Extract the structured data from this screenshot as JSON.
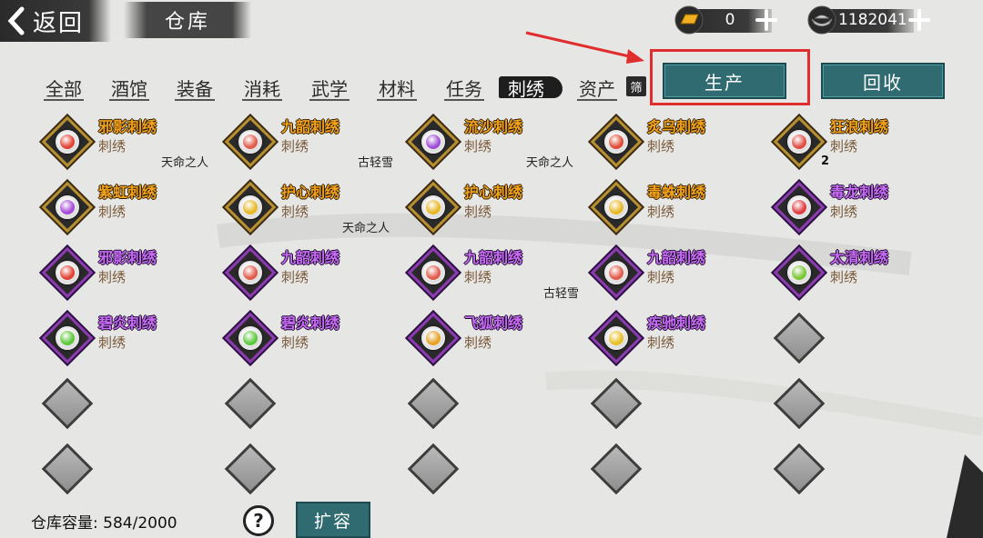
{
  "header": {
    "back_label": "返回",
    "warehouse_tab": "仓库",
    "gold_value": "0",
    "silver_value": "1182041",
    "gold_icon": "gold-ingot-icon",
    "silver_icon": "silver-ingot-icon"
  },
  "categories": [
    {
      "label": "全部",
      "active": false
    },
    {
      "label": "酒馆",
      "active": false
    },
    {
      "label": "装备",
      "active": false
    },
    {
      "label": "消耗",
      "active": false
    },
    {
      "label": "武学",
      "active": false
    },
    {
      "label": "材料",
      "active": false
    },
    {
      "label": "任务",
      "active": false
    },
    {
      "label": "刺绣",
      "active": true
    },
    {
      "label": "资产",
      "active": false
    }
  ],
  "filter_label": "筛",
  "actions": {
    "produce": "生产",
    "recycle": "回收"
  },
  "items": [
    {
      "name": "邪影刺绣",
      "type": "刺绣",
      "rarity": "gold",
      "orb": "#e24030",
      "owner": ""
    },
    {
      "name": "九韶刺绣",
      "type": "刺绣",
      "rarity": "gold",
      "orb": "#e25a4a",
      "owner": ""
    },
    {
      "name": "流沙刺绣",
      "type": "刺绣",
      "rarity": "gold",
      "orb": "#a04ad8",
      "owner": "天命之人"
    },
    {
      "name": "炙乌刺绣",
      "type": "刺绣",
      "rarity": "gold",
      "orb": "#e04a30",
      "owner": "古轻雪"
    },
    {
      "name": "狂浪刺绣",
      "type": "刺绣",
      "rarity": "gold",
      "orb": "#e04a40",
      "owner": "天命之人",
      "count": "2"
    },
    {
      "name": "紫虹刺绣",
      "type": "刺绣",
      "rarity": "gold",
      "orb": "#a648d8",
      "owner": ""
    },
    {
      "name": "护心刺绣",
      "type": "刺绣",
      "rarity": "gold",
      "orb": "#e8b820",
      "owner": ""
    },
    {
      "name": "护心刺绣",
      "type": "刺绣",
      "rarity": "gold",
      "orb": "#e8b820",
      "owner": "天命之人"
    },
    {
      "name": "毒蛛刺绣",
      "type": "刺绣",
      "rarity": "gold",
      "orb": "#e8b820",
      "owner": ""
    },
    {
      "name": "毒龙刺绣",
      "type": "刺绣",
      "rarity": "purple",
      "orb": "#e03a40",
      "owner": ""
    },
    {
      "name": "邪影刺绣",
      "type": "刺绣",
      "rarity": "purple",
      "orb": "#e24030",
      "owner": ""
    },
    {
      "name": "九韶刺绣",
      "type": "刺绣",
      "rarity": "purple",
      "orb": "#e25a4a",
      "owner": ""
    },
    {
      "name": "九韶刺绣",
      "type": "刺绣",
      "rarity": "purple",
      "orb": "#e25a4a",
      "owner": ""
    },
    {
      "name": "九韶刺绣",
      "type": "刺绣",
      "rarity": "purple",
      "orb": "#e25a4a",
      "owner": "古轻雪"
    },
    {
      "name": "太清刺绣",
      "type": "刺绣",
      "rarity": "purple",
      "orb": "#78c830",
      "owner": ""
    },
    {
      "name": "碧炎刺绣",
      "type": "刺绣",
      "rarity": "purple",
      "orb": "#5ac838",
      "owner": ""
    },
    {
      "name": "碧炎刺绣",
      "type": "刺绣",
      "rarity": "purple",
      "orb": "#5ac838",
      "owner": ""
    },
    {
      "name": "飞狐刺绣",
      "type": "刺绣",
      "rarity": "purple",
      "orb": "#e8a020",
      "owner": ""
    },
    {
      "name": "疾驰刺绣",
      "type": "刺绣",
      "rarity": "purple",
      "orb": "#e8c020",
      "owner": ""
    }
  ],
  "footer": {
    "capacity_label": "仓库容量:",
    "capacity_value": "584/2000",
    "help": "?",
    "expand": "扩容"
  }
}
